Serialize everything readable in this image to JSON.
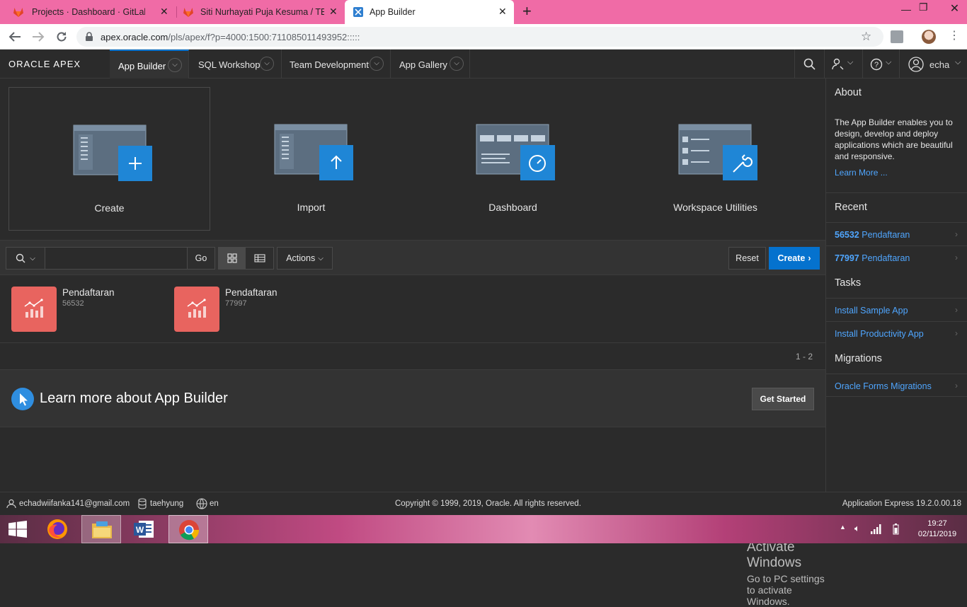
{
  "browser": {
    "tabs": [
      {
        "title": "Projects · Dashboard · GitLab",
        "close": "✕"
      },
      {
        "title": "Siti Nurhayati Puja Kesuma / TB D",
        "close": "✕"
      },
      {
        "title": "App Builder",
        "close": "✕"
      }
    ],
    "new_tab": "+",
    "url_host": "apex.oracle.com",
    "url_path": "/pls/apex/f?p=4000:1500:711085011493952:::::"
  },
  "apex_nav": {
    "logo": "ORACLE APEX",
    "tabs": [
      {
        "label": "App Builder"
      },
      {
        "label": "SQL Workshop"
      },
      {
        "label": "Team Development"
      },
      {
        "label": "App Gallery"
      }
    ],
    "user": "echa"
  },
  "tiles": [
    {
      "label": "Create"
    },
    {
      "label": "Import"
    },
    {
      "label": "Dashboard"
    },
    {
      "label": "Workspace Utilities"
    }
  ],
  "toolbar": {
    "go": "Go",
    "actions": "Actions",
    "reset": "Reset",
    "create": "Create"
  },
  "apps": [
    {
      "name": "Pendaftaran",
      "id": "56532"
    },
    {
      "name": "Pendaftaran",
      "id": "77997"
    }
  ],
  "pagination": "1 - 2",
  "learn": {
    "title": "Learn more about App Builder",
    "button": "Get Started"
  },
  "sidebar": {
    "about_title": "About",
    "about_text": "The App Builder enables you to design, develop and deploy applications which are beautiful and responsive.",
    "learn_more": "Learn More ...",
    "recent_title": "Recent",
    "recent": [
      {
        "id": "56532",
        "name": "Pendaftaran"
      },
      {
        "id": "77997",
        "name": "Pendaftaran"
      }
    ],
    "tasks_title": "Tasks",
    "tasks": [
      "Install Sample App",
      "Install Productivity App"
    ],
    "migrations_title": "Migrations",
    "migrations": [
      "Oracle Forms Migrations"
    ]
  },
  "footer": {
    "email": "echadwiifanka141@gmail.com",
    "workspace": "taehyung",
    "language": "en",
    "copyright": "Copyright © 1999, 2019, Oracle. All rights reserved.",
    "version": "Application Express 19.2.0.00.18"
  },
  "watermark": {
    "line1": "Activate Windows",
    "line2": "Go to PC settings to activate Windows."
  },
  "taskbar": {
    "time": "19:27",
    "date": "02/11/2019"
  },
  "colors": {
    "accent": "#0572ce",
    "link": "#4fa6ff",
    "app_icon": "#e8645f",
    "tile_blue": "#1f86d6",
    "tab_strip": "#f06ba6"
  }
}
